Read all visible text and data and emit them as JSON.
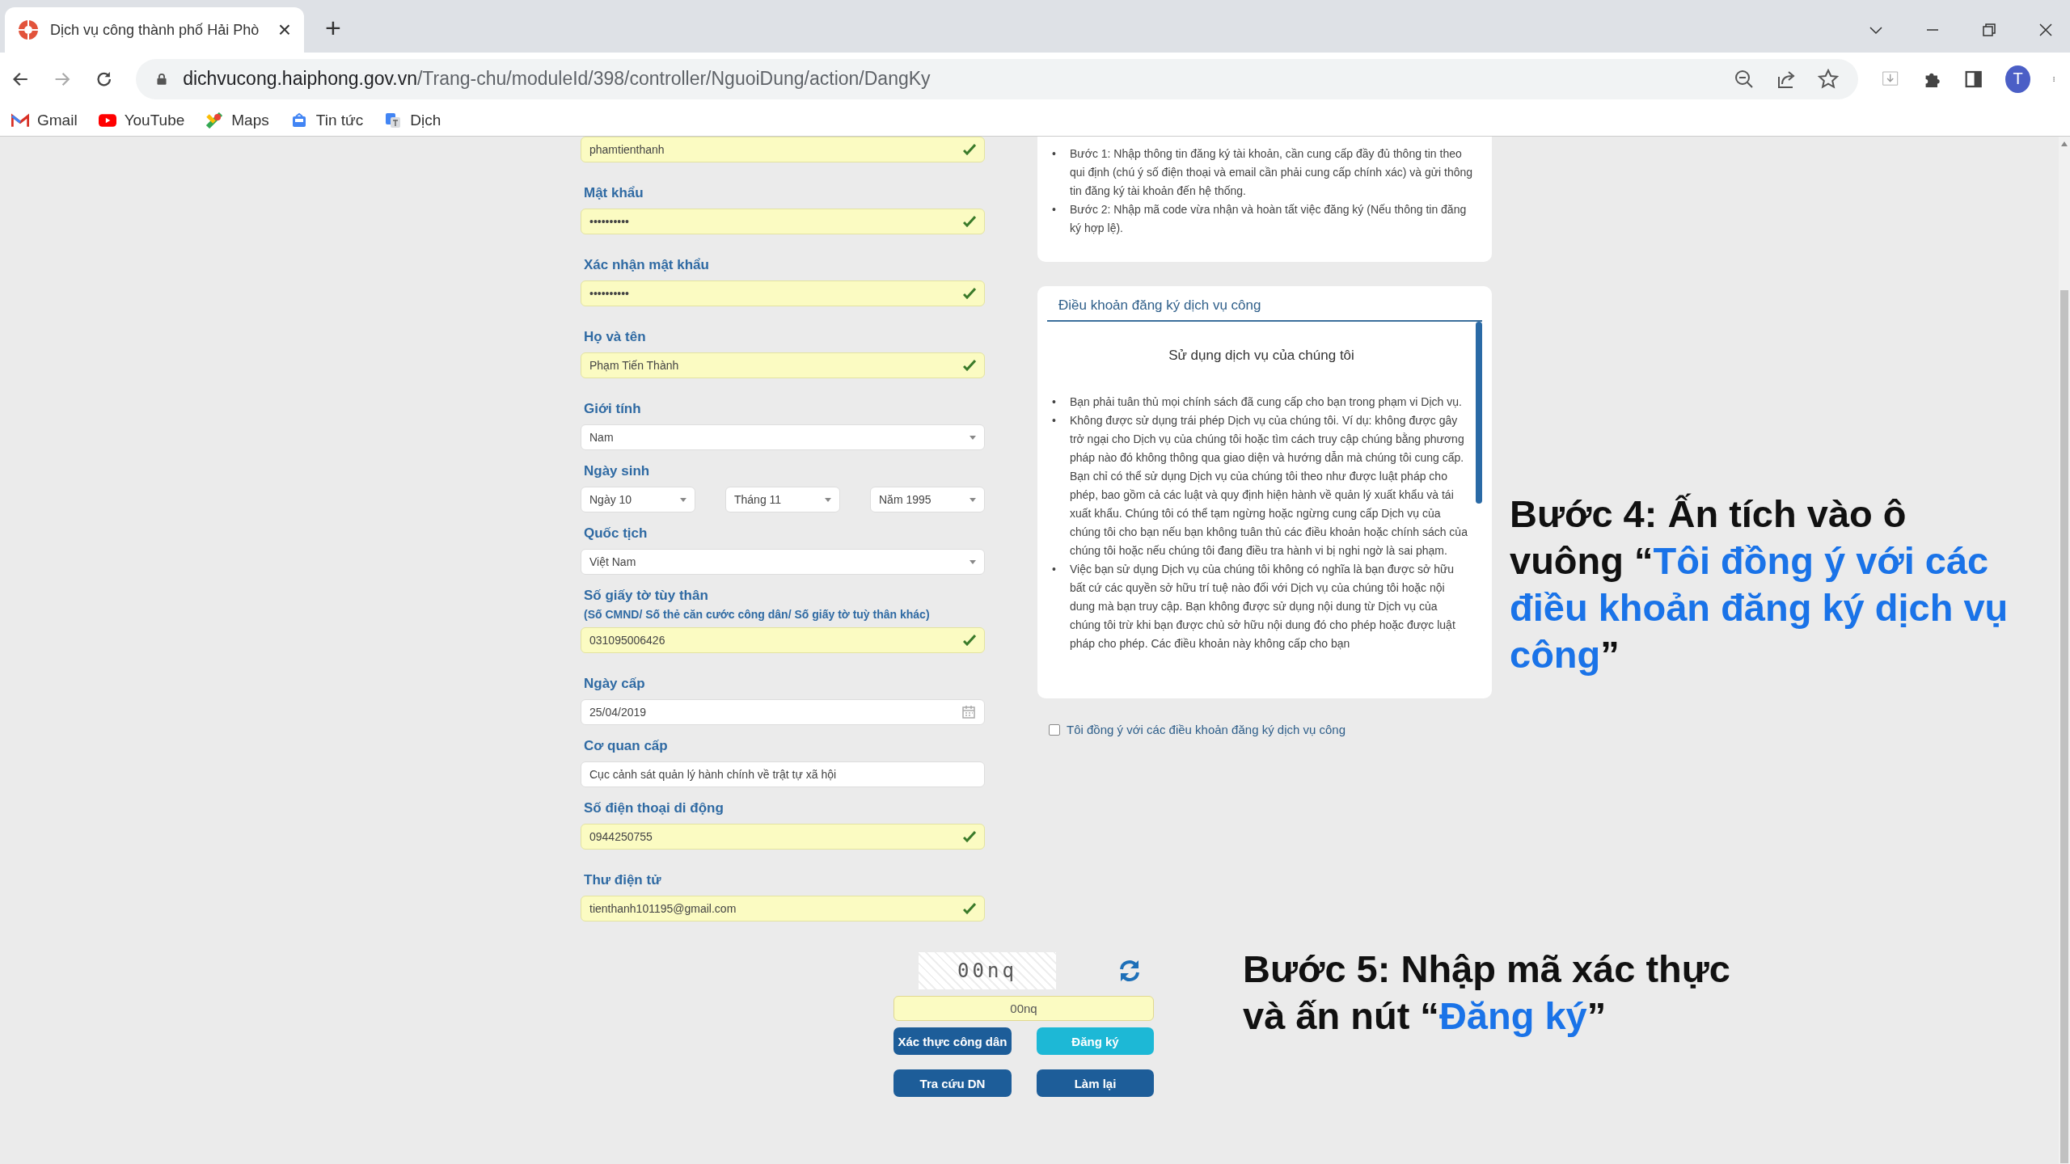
{
  "browser": {
    "tab": {
      "title": "Dịch vụ công thành phố Hải Phò",
      "close": "×"
    },
    "new_tab": "+",
    "url": {
      "host": "dichvucong.haiphong.gov.vn",
      "path": "/Trang-chu/moduleId/398/controller/NguoiDung/action/DangKy"
    },
    "avatar": "T",
    "bookmarks": [
      {
        "label": "Gmail",
        "kind": "gmail"
      },
      {
        "label": "YouTube",
        "kind": "youtube"
      },
      {
        "label": "Maps",
        "kind": "maps"
      },
      {
        "label": "Tin tức",
        "kind": "news"
      },
      {
        "label": "Dịch",
        "kind": "translate"
      }
    ]
  },
  "form": {
    "fields": [
      {
        "kind": "input",
        "value": "phamtienthanh",
        "valid": true
      },
      {
        "kind": "input",
        "label": "Mật khẩu",
        "value": "••••••••••",
        "valid": true
      },
      {
        "kind": "input",
        "label": "Xác nhận mật khẩu",
        "value": "••••••••••",
        "valid": true
      },
      {
        "kind": "input",
        "label": "Họ và tên",
        "value": "Phạm Tiến Thành",
        "valid": true
      },
      {
        "kind": "select",
        "label": "Giới tính",
        "value": "Nam"
      },
      {
        "kind": "selects",
        "label": "Ngày sinh",
        "values": [
          "Ngày 10",
          "Tháng 11",
          "Năm 1995"
        ]
      },
      {
        "kind": "select",
        "label": "Quốc tịch",
        "value": "Việt Nam"
      },
      {
        "kind": "input",
        "label": "Số giấy tờ tùy thân",
        "hint": "(Số CMND/ Số thẻ căn cước công dân/ Số giấy tờ tuỳ thân khác)",
        "value": "031095006426",
        "valid": true
      },
      {
        "kind": "date",
        "label": "Ngày cấp",
        "value": "25/04/2019"
      },
      {
        "kind": "input",
        "label": "Cơ quan cấp",
        "value": "Cục cảnh sát quản lý hành chính về trật tự xã hội",
        "valid": false
      },
      {
        "kind": "input",
        "label": "Số điện thoại di động",
        "value": "0944250755",
        "valid": true
      },
      {
        "kind": "input",
        "label": "Thư điện tử",
        "value": "tienthanh101195@gmail.com",
        "valid": true
      }
    ]
  },
  "guide": {
    "bullet": "•",
    "steps": [
      "Bước 1: Nhập thông tin đăng ký tài khoản, cần cung cấp đầy đủ thông tin theo qui định (chú ý số điện thoại và email cần phải cung cấp chính xác) và gửi thông tin đăng ký tài khoản đến hệ thống.",
      "Bước 2: Nhập mã code vừa nhận và hoàn tất việc đăng ký (Nếu thông tin đăng ký hợp lệ)."
    ]
  },
  "terms": {
    "title": "Điều khoản đăng ký dịch vụ công",
    "heading": "Sử dụng dịch vụ của chúng tôi",
    "bullet": "•",
    "items": [
      "Bạn phải tuân thủ mọi chính sách đã cung cấp cho bạn trong phạm vi Dịch vụ.",
      "Không được sử dụng trái phép Dịch vụ của chúng tôi. Ví dụ: không được gây trở ngại cho Dịch vụ của chúng tôi hoặc tìm cách truy cập chúng bằng phương pháp nào đó không thông qua giao diện và hướng dẫn mà chúng tôi cung cấp. Bạn chỉ có thể sử dụng Dịch vụ của chúng tôi theo như được luật pháp cho phép, bao gồm cả các luật và quy định hiện hành về quản lý xuất khẩu và tái xuất khẩu. Chúng tôi có thể tạm ngừng hoặc ngừng cung cấp Dịch vụ của chúng tôi cho bạn nếu bạn không tuân thủ các điều khoản hoặc chính sách của chúng tôi hoặc nếu chúng tôi đang điều tra hành vi bị nghi ngờ là sai phạm.",
      "Việc bạn sử dụng Dịch vụ của chúng tôi không có nghĩa là bạn được sở hữu bất cứ các quyền sở hữu trí tuệ nào đối với Dịch vụ của chúng tôi hoặc nội dung mà bạn truy cập. Bạn không được sử dụng nội dung từ Dịch vụ của chúng tôi trừ khi bạn được chủ sở hữu nội dung đó cho phép hoặc được luật pháp cho phép. Các điều khoản này không cấp cho bạn"
    ]
  },
  "agreement": {
    "label": "Tôi đồng ý với các điều khoản đăng ký dịch vụ công",
    "checked": false
  },
  "captcha": {
    "image_text": "00nq",
    "value": "00nq"
  },
  "buttons": [
    {
      "label": "Xác thực công dân",
      "kind": "primary"
    },
    {
      "label": "Đăng ký",
      "kind": "accent"
    },
    {
      "label": "Tra cứu DN",
      "kind": "primary"
    },
    {
      "label": "Làm lại",
      "kind": "primary"
    }
  ],
  "annotations": [
    {
      "parts": [
        {
          "text": "Bước 4: Ấn tích vào ô vuông “",
          "highlight": false
        },
        {
          "text": "Tôi đồng ý với các điều khoản đăng ký dịch vụ công",
          "highlight": true
        },
        {
          "text": "”",
          "highlight": false
        }
      ]
    },
    {
      "parts": [
        {
          "text": "Bước 5: Nhập mã xác thực và ấn nút “",
          "highlight": false
        },
        {
          "text": "Đăng ký",
          "highlight": true
        },
        {
          "text": "”",
          "highlight": false
        }
      ]
    }
  ]
}
